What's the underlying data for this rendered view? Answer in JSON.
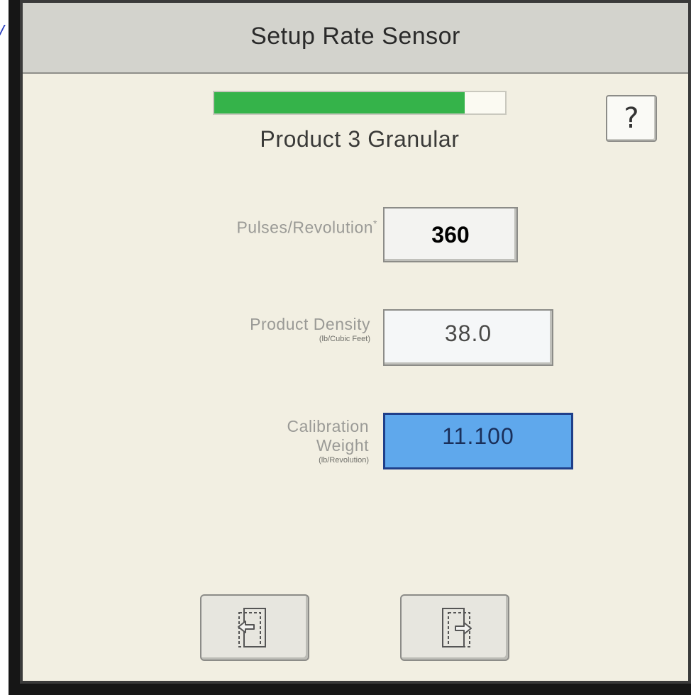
{
  "screen": {
    "title": "Setup Rate Sensor",
    "progress_fraction": 0.86,
    "progress_color": "#35b34a",
    "product_name": "Product 3 Granular",
    "help_label": "?"
  },
  "fields": {
    "pulses": {
      "label": "Pulses/Revolution",
      "marker": "*",
      "value": "360"
    },
    "density": {
      "label": "Product Density",
      "unit": "(lb/Cubic Feet)",
      "value": "38.0"
    },
    "calibration": {
      "label_line1": "Calibration",
      "label_line2": "Weight",
      "unit": "(lb/Revolution)",
      "value": "11.100",
      "highlight_color": "#5fa8ec"
    }
  },
  "navigation": {
    "back_icon": "page-back-icon",
    "next_icon": "page-forward-icon"
  }
}
